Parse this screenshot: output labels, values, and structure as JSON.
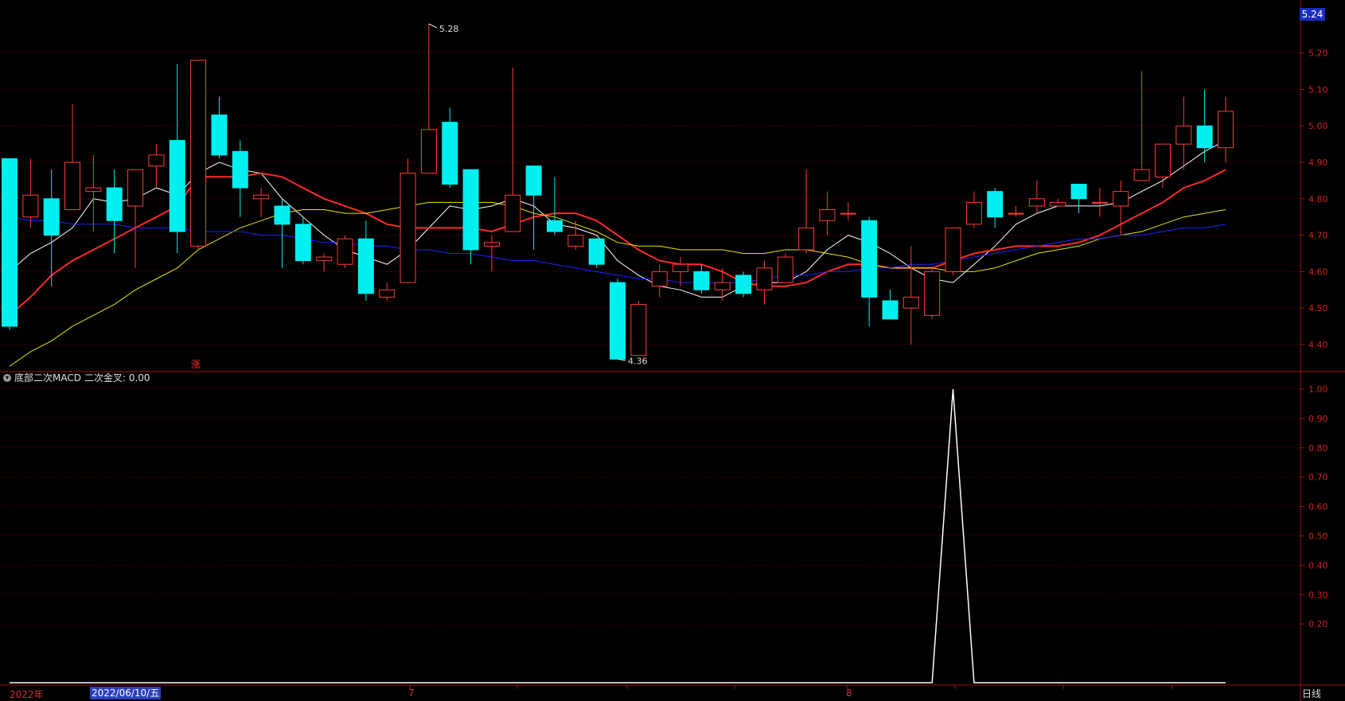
{
  "colors": {
    "up": "#ff3b3b",
    "down": "#00f0f0",
    "grid": "#5a0000",
    "axis": "#a01010",
    "ma5": "#ffffff",
    "ma10": "#ff2a2a",
    "ma20": "#e6e600",
    "ma60": "#2020ff",
    "indicator": "#ffffff"
  },
  "price_axis": {
    "ticks": [
      "5.20",
      "5.10",
      "5.00",
      "4.90",
      "4.80",
      "4.70",
      "4.60",
      "4.50",
      "4.40"
    ],
    "current": "5.24"
  },
  "indicator_axis": {
    "ticks": [
      "1.00",
      "0.90",
      "0.80",
      "0.70",
      "0.60",
      "0.50",
      "0.40",
      "0.30",
      "0.20"
    ]
  },
  "indicator_header": {
    "toggle_icon": "chevron-down-icon",
    "name": "底部二次MACD",
    "field": "二次金叉: 0.00"
  },
  "annotations": {
    "high": "5.28",
    "low": "4.36",
    "rise_mark": "涨"
  },
  "time_axis": {
    "year": "2022年",
    "selected_date": "2022/06/10/五",
    "month_7": "7",
    "month_8": "8",
    "period": "日线"
  },
  "chart_data": {
    "type": "candlestick",
    "candles": [
      [
        4.91,
        4.45,
        4.91,
        4.44
      ],
      [
        4.75,
        4.81,
        4.91,
        4.72
      ],
      [
        4.8,
        4.7,
        4.88,
        4.56
      ],
      [
        4.77,
        4.9,
        5.06,
        4.77
      ],
      [
        4.82,
        4.83,
        4.92,
        4.71
      ],
      [
        4.83,
        4.74,
        4.88,
        4.65
      ],
      [
        4.78,
        4.88,
        4.88,
        4.61
      ],
      [
        4.89,
        4.92,
        4.95,
        4.83
      ],
      [
        4.96,
        4.71,
        5.17,
        4.65
      ],
      [
        4.67,
        5.18,
        5.18,
        4.66
      ],
      [
        5.03,
        4.92,
        5.08,
        4.91
      ],
      [
        4.93,
        4.83,
        4.96,
        4.75
      ],
      [
        4.8,
        4.81,
        4.83,
        4.75
      ],
      [
        4.78,
        4.73,
        4.8,
        4.61
      ],
      [
        4.73,
        4.63,
        4.75,
        4.62
      ],
      [
        4.63,
        4.64,
        4.65,
        4.6
      ],
      [
        4.62,
        4.69,
        4.7,
        4.61
      ],
      [
        4.69,
        4.54,
        4.74,
        4.52
      ],
      [
        4.53,
        4.55,
        4.57,
        4.52
      ],
      [
        4.57,
        4.87,
        4.91,
        4.57
      ],
      [
        4.87,
        4.99,
        5.28,
        4.87
      ],
      [
        5.01,
        4.84,
        5.05,
        4.83
      ],
      [
        4.88,
        4.66,
        4.88,
        4.62
      ],
      [
        4.67,
        4.68,
        4.7,
        4.6
      ],
      [
        4.71,
        4.81,
        5.16,
        4.71
      ],
      [
        4.89,
        4.81,
        4.89,
        4.66
      ],
      [
        4.74,
        4.71,
        4.86,
        4.7
      ],
      [
        4.67,
        4.7,
        4.74,
        4.66
      ],
      [
        4.69,
        4.62,
        4.69,
        4.61
      ],
      [
        4.57,
        4.36,
        4.58,
        4.36
      ],
      [
        4.37,
        4.51,
        4.52,
        4.37
      ],
      [
        4.56,
        4.6,
        4.62,
        4.53
      ],
      [
        4.6,
        4.62,
        4.64,
        4.56
      ],
      [
        4.6,
        4.55,
        4.62,
        4.54
      ],
      [
        4.55,
        4.57,
        4.61,
        4.52
      ],
      [
        4.59,
        4.54,
        4.6,
        4.53
      ],
      [
        4.55,
        4.61,
        4.63,
        4.51
      ],
      [
        4.57,
        4.64,
        4.65,
        4.57
      ],
      [
        4.66,
        4.72,
        4.88,
        4.65
      ],
      [
        4.74,
        4.77,
        4.82,
        4.7
      ],
      [
        4.76,
        4.76,
        4.79,
        4.74
      ],
      [
        4.74,
        4.53,
        4.75,
        4.45
      ],
      [
        4.52,
        4.47,
        4.55,
        4.47
      ],
      [
        4.5,
        4.53,
        4.67,
        4.4
      ],
      [
        4.48,
        4.6,
        4.61,
        4.47
      ],
      [
        4.6,
        4.72,
        4.72,
        4.59
      ],
      [
        4.73,
        4.79,
        4.82,
        4.72
      ],
      [
        4.82,
        4.75,
        4.83,
        4.72
      ],
      [
        4.76,
        4.76,
        4.78,
        4.75
      ],
      [
        4.78,
        4.8,
        4.85,
        4.76
      ],
      [
        4.78,
        4.79,
        4.8,
        4.78
      ],
      [
        4.84,
        4.8,
        4.84,
        4.76
      ],
      [
        4.79,
        4.79,
        4.83,
        4.75
      ],
      [
        4.78,
        4.82,
        4.85,
        4.7
      ],
      [
        4.85,
        4.88,
        5.15,
        4.85
      ],
      [
        4.86,
        4.95,
        4.95,
        4.83
      ],
      [
        4.95,
        5.0,
        5.08,
        4.88
      ],
      [
        5.0,
        4.94,
        5.1,
        4.9
      ],
      [
        4.94,
        5.04,
        5.08,
        4.9
      ]
    ],
    "ma_lines": [
      {
        "values": [
          4.6,
          4.65,
          4.68,
          4.72,
          4.8,
          4.79,
          4.8,
          4.83,
          4.81,
          4.87,
          4.9,
          4.88,
          4.87,
          4.8,
          4.75,
          4.7,
          4.66,
          4.64,
          4.62,
          4.66,
          4.72,
          4.78,
          4.77,
          4.78,
          4.8,
          4.78,
          4.73,
          4.72,
          4.7,
          4.63,
          4.59,
          4.56,
          4.55,
          4.53,
          4.53,
          4.56,
          4.57,
          4.57,
          4.6,
          4.66,
          4.7,
          4.68,
          4.65,
          4.61,
          4.58,
          4.57,
          4.62,
          4.67,
          4.73,
          4.76,
          4.78,
          4.78,
          4.78,
          4.79,
          4.82,
          4.85,
          4.89,
          4.93,
          4.96
        ]
      },
      {
        "values": [
          4.48,
          4.53,
          4.59,
          4.63,
          4.66,
          4.69,
          4.72,
          4.75,
          4.78,
          4.86,
          4.86,
          4.86,
          4.87,
          4.86,
          4.83,
          4.8,
          4.78,
          4.76,
          4.73,
          4.72,
          4.72,
          4.72,
          4.72,
          4.71,
          4.73,
          4.75,
          4.76,
          4.76,
          4.74,
          4.7,
          4.66,
          4.63,
          4.62,
          4.62,
          4.6,
          4.57,
          4.56,
          4.56,
          4.57,
          4.6,
          4.62,
          4.62,
          4.61,
          4.61,
          4.61,
          4.63,
          4.65,
          4.66,
          4.67,
          4.67,
          4.67,
          4.68,
          4.7,
          4.73,
          4.76,
          4.79,
          4.83,
          4.85,
          4.88
        ]
      },
      {
        "values": [
          4.34,
          4.38,
          4.41,
          4.45,
          4.48,
          4.51,
          4.55,
          4.58,
          4.61,
          4.66,
          4.69,
          4.72,
          4.74,
          4.76,
          4.77,
          4.77,
          4.76,
          4.76,
          4.77,
          4.78,
          4.79,
          4.79,
          4.79,
          4.79,
          4.78,
          4.76,
          4.75,
          4.73,
          4.71,
          4.68,
          4.67,
          4.67,
          4.66,
          4.66,
          4.66,
          4.65,
          4.65,
          4.66,
          4.66,
          4.65,
          4.64,
          4.62,
          4.61,
          4.61,
          4.61,
          4.6,
          4.6,
          4.61,
          4.63,
          4.65,
          4.66,
          4.67,
          4.69,
          4.7,
          4.71,
          4.73,
          4.75,
          4.76,
          4.77
        ]
      },
      {
        "values": [
          4.75,
          4.74,
          4.74,
          4.73,
          4.73,
          4.73,
          4.72,
          4.72,
          4.72,
          4.71,
          4.71,
          4.71,
          4.7,
          4.7,
          4.69,
          4.68,
          4.68,
          4.67,
          4.67,
          4.66,
          4.66,
          4.65,
          4.65,
          4.64,
          4.63,
          4.63,
          4.62,
          4.61,
          4.6,
          4.59,
          4.58,
          4.58,
          4.57,
          4.57,
          4.57,
          4.57,
          4.58,
          4.59,
          4.59,
          4.6,
          4.6,
          4.61,
          4.61,
          4.62,
          4.62,
          4.63,
          4.64,
          4.65,
          4.66,
          4.67,
          4.68,
          4.69,
          4.69,
          4.7,
          4.7,
          4.71,
          4.72,
          4.72,
          4.73
        ]
      }
    ],
    "indicator": {
      "name": "二次金叉",
      "values": [
        0,
        0,
        0,
        0,
        0,
        0,
        0,
        0,
        0,
        0,
        0,
        0,
        0,
        0,
        0,
        0,
        0,
        0,
        0,
        0,
        0,
        0,
        0,
        0,
        0,
        0,
        0,
        0,
        0,
        0,
        0,
        0,
        0,
        0,
        0,
        0,
        0,
        0,
        0,
        0,
        0,
        0,
        0,
        0,
        0,
        1,
        0,
        0,
        0,
        0,
        0,
        0,
        0,
        0,
        0,
        0,
        0,
        0,
        0
      ]
    },
    "price_range": [
      4.33,
      5.28
    ],
    "indicator_range": [
      0,
      1.0
    ]
  }
}
